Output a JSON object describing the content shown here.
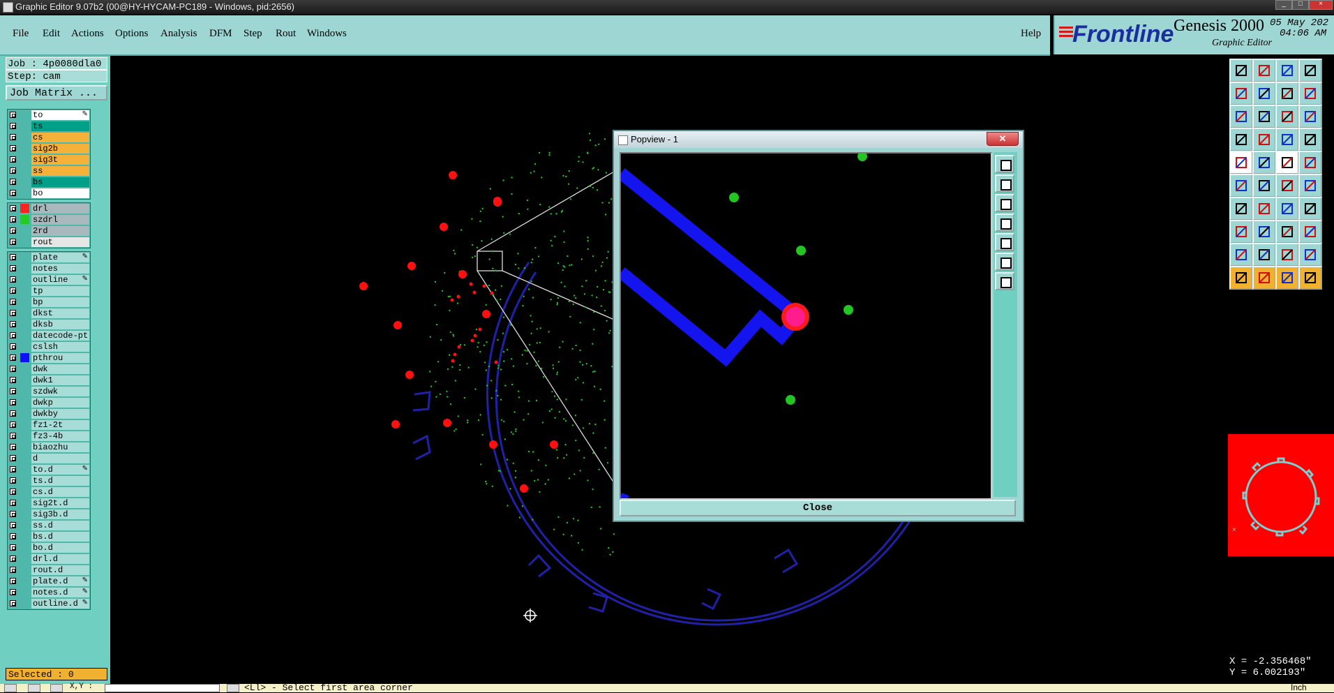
{
  "window": {
    "title": "Graphic Editor 9.07b2 (00@HY-HYCAM-PC189 - Windows, pid:2656)"
  },
  "menu": {
    "items": [
      "File",
      "Edit",
      "Actions",
      "Options",
      "Analysis",
      "DFM",
      "Step",
      "Rout",
      "Windows"
    ],
    "help": "Help"
  },
  "brand": {
    "logo": "Frontline",
    "product": "Genesis 2000",
    "subtitle": "Graphic Editor",
    "date": "05 May 202",
    "time": "04:06 AM"
  },
  "job": {
    "job_line": "Job : 4p0080dla0",
    "step_line": "Step: cam",
    "matrix_button": "Job Matrix ..."
  },
  "layers": {
    "board": [
      {
        "name": "to",
        "color": "#ffffff",
        "edit": true
      },
      {
        "name": "ts",
        "color": "#009f8a",
        "edit": false
      },
      {
        "name": "cs",
        "color": "#f5b13a",
        "edit": false
      },
      {
        "name": "sig2b",
        "color": "#f5b13a",
        "edit": false
      },
      {
        "name": "sig3t",
        "color": "#f5b13a",
        "edit": false
      },
      {
        "name": "ss",
        "color": "#f5b13a",
        "edit": false
      },
      {
        "name": "bs",
        "color": "#009f8a",
        "edit": false
      },
      {
        "name": "bo",
        "color": "#ffffff",
        "edit": false
      }
    ],
    "drill": [
      {
        "name": "drl",
        "color": "#a9b8bd",
        "swatch": "#ff2020",
        "edit": false,
        "active": true
      },
      {
        "name": "szdrl",
        "color": "#a9b8bd",
        "swatch": "#22cc22",
        "edit": false
      },
      {
        "name": "2rd",
        "color": "#a9b8bd",
        "edit": false
      },
      {
        "name": "rout",
        "color": "#e6e6e6",
        "edit": false
      }
    ],
    "misc": [
      {
        "name": "plate",
        "edit": true
      },
      {
        "name": "notes",
        "edit": false
      },
      {
        "name": "outline",
        "edit": true
      },
      {
        "name": "tp",
        "edit": false
      },
      {
        "name": "bp",
        "edit": false
      },
      {
        "name": "dkst",
        "edit": false
      },
      {
        "name": "dksb",
        "edit": false
      },
      {
        "name": "datecode-pt",
        "edit": false
      },
      {
        "name": "cslsh",
        "edit": false
      },
      {
        "name": "pthrou",
        "edit": false,
        "swatch": "#1010ff"
      },
      {
        "name": "dwk",
        "edit": false
      },
      {
        "name": "dwk1",
        "edit": false
      },
      {
        "name": "szdwk",
        "edit": false
      },
      {
        "name": "dwkp",
        "edit": false
      },
      {
        "name": "dwkby",
        "edit": false
      },
      {
        "name": "fz1-2t",
        "edit": false
      },
      {
        "name": "fz3-4b",
        "edit": false
      },
      {
        "name": "biaozhu",
        "edit": false
      },
      {
        "name": "d",
        "edit": false
      },
      {
        "name": "to.d",
        "edit": true
      },
      {
        "name": "ts.d",
        "edit": false
      },
      {
        "name": "cs.d",
        "edit": false
      },
      {
        "name": "sig2t.d",
        "edit": false
      },
      {
        "name": "sig3b.d",
        "edit": false
      },
      {
        "name": "ss.d",
        "edit": false
      },
      {
        "name": "bs.d",
        "edit": false
      },
      {
        "name": "bo.d",
        "edit": false
      },
      {
        "name": "drl.d",
        "edit": false
      },
      {
        "name": "rout.d",
        "edit": false
      },
      {
        "name": "plate.d",
        "edit": true
      },
      {
        "name": "notes.d",
        "edit": true
      },
      {
        "name": "outline.d",
        "edit": true
      }
    ]
  },
  "selected": "Selected : 0",
  "popview": {
    "title": "Popview - 1",
    "close_label": "Close"
  },
  "coords": {
    "x": "X = -2.356468\"",
    "y": "Y = 6.002193\""
  },
  "status": {
    "message": "<Ll> - Select first area corner",
    "xy_label": "X,Y :",
    "unit": "Inch"
  },
  "colors": {
    "panel": "#6fd0c2",
    "menu": "#9ed6d4",
    "drill": "#ff2020",
    "via": "#22cc22",
    "trace": "#1010ff"
  }
}
